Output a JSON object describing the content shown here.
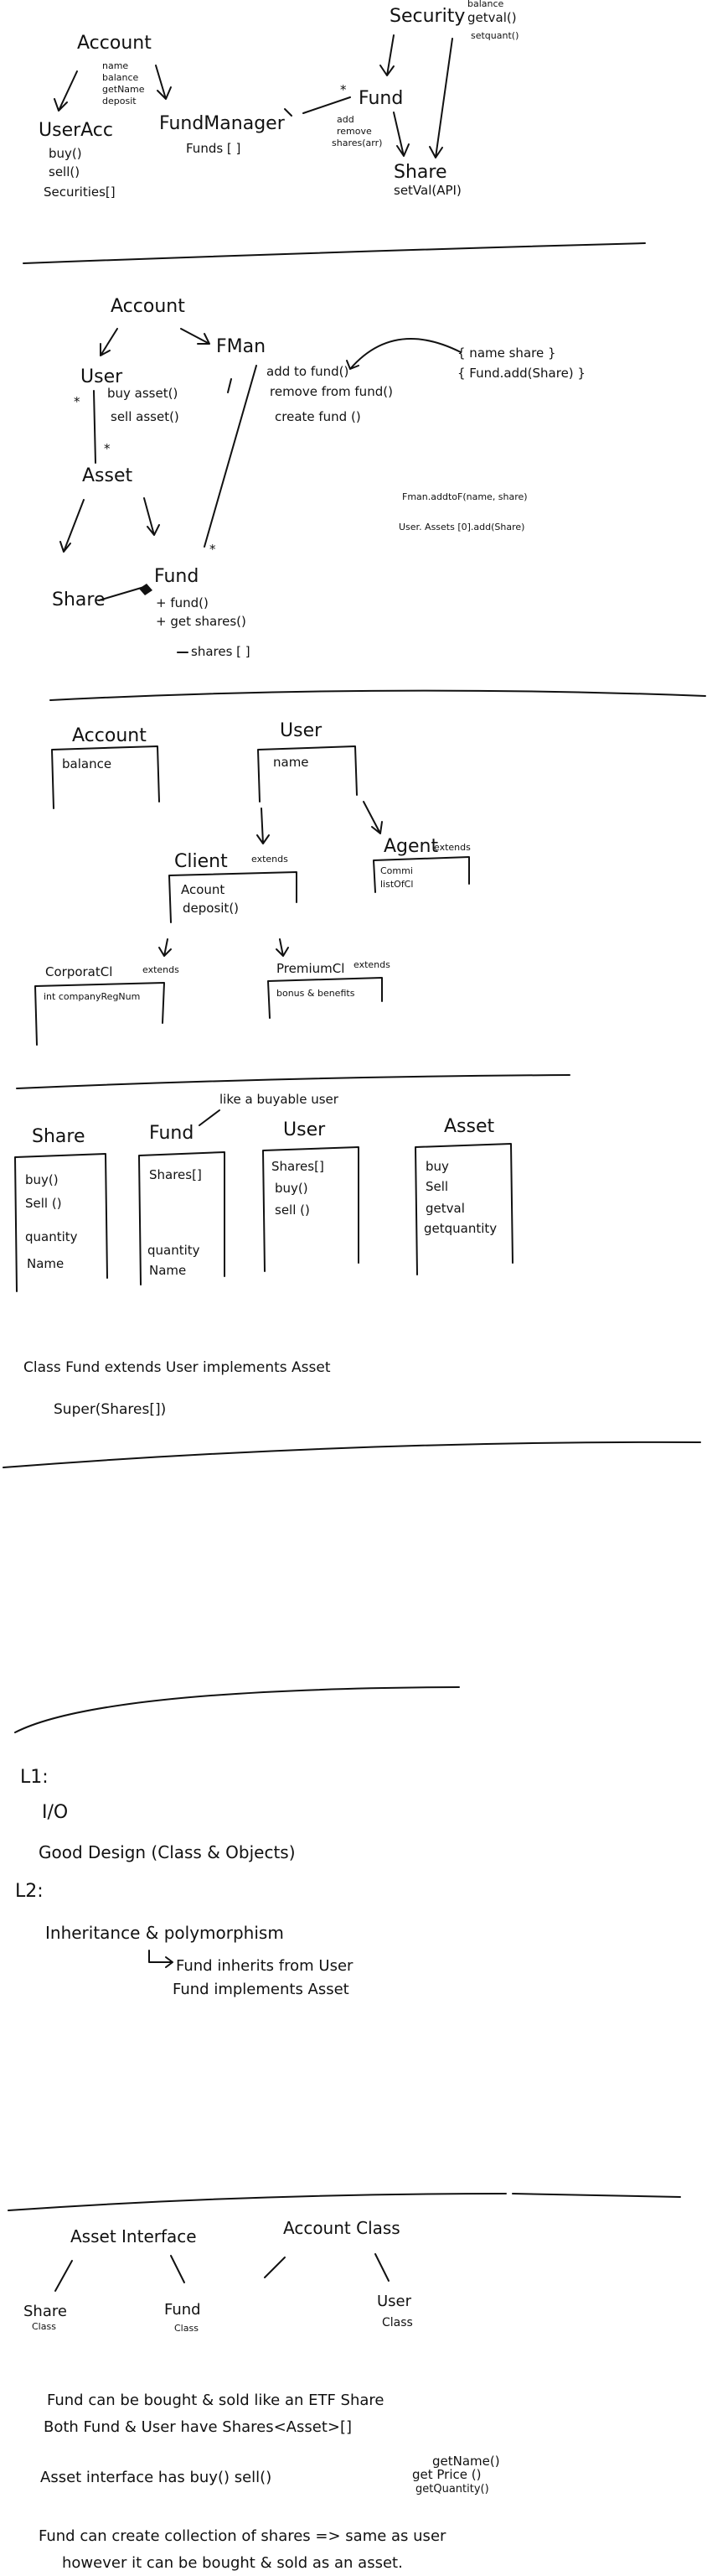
{
  "s1": {
    "account": {
      "title": "Account",
      "fields": [
        "name",
        "balance",
        "getName",
        "deposit"
      ]
    },
    "useracc": {
      "title": "UserAcc",
      "methods": [
        "buy()",
        "sell()",
        "Securities[]"
      ]
    },
    "fundmanager": {
      "title": "FundManager",
      "fields": [
        "Funds [ ]"
      ]
    },
    "security": {
      "title": "Security",
      "methods": [
        "balance",
        "getval()",
        "setquant()"
      ]
    },
    "fund": {
      "title": "Fund",
      "methods": [
        "add",
        "remove",
        "shares(arr)"
      ]
    },
    "share": {
      "title": "Share",
      "methods": [
        "setVal(API)"
      ]
    },
    "star": "*"
  },
  "s2": {
    "account": "Account",
    "user": "User",
    "user_methods": [
      "buy asset()",
      "sell asset()"
    ],
    "fman": "FMan",
    "fman_methods": [
      "add to fund()",
      "remove from fund()",
      "create fund ()"
    ],
    "brace_note": [
      "{ name   share }",
      "{ Fund.add(Share) }"
    ],
    "asset": "Asset",
    "share": "Share",
    "fund": "Fund",
    "fund_methods": [
      "+ fund()",
      "+ get shares()"
    ],
    "shares_note": "shares [ ]",
    "code_lines": [
      "Fman.addtoF(name, share)",
      "User. Assets [0].add(Share)"
    ],
    "star": "*"
  },
  "s3": {
    "account": {
      "title": "Account",
      "field": "balance"
    },
    "user": {
      "title": "User",
      "field": "name"
    },
    "client": {
      "title": "Client",
      "ext": "extends",
      "fields": [
        "Acount",
        "deposit()"
      ]
    },
    "agent": {
      "title": "Agent",
      "ext": "extends",
      "fields": [
        "Commi",
        "listOfCl"
      ]
    },
    "corporate": {
      "title": "CorporatCl",
      "ext": "extends",
      "field": "int companyRegNum"
    },
    "premium": {
      "title": "PremiumCl",
      "ext": "extends",
      "field": "bonus & benefits"
    }
  },
  "s4": {
    "note": "like a buyable user",
    "share": {
      "title": "Share",
      "items": [
        "buy()",
        "Sell ()",
        "quantity",
        "Name"
      ]
    },
    "fund": {
      "title": "Fund",
      "items": [
        "Shares[]",
        "quantity",
        "Name"
      ]
    },
    "user": {
      "title": "User",
      "items": [
        "Shares[]",
        "buy()",
        "sell ()"
      ]
    },
    "asset": {
      "title": "Asset",
      "items": [
        "buy",
        "Sell",
        "getval",
        "getquantity"
      ]
    },
    "code": [
      "Class Fund extends User implements Asset",
      "Super(Shares[])"
    ]
  },
  "s5": {
    "lines": [
      "L1:",
      "I/O",
      "Good Design (Class & Objects)",
      "L2:",
      "Inheritance & polymorphism",
      "Fund inherits from User",
      "Fund implements Asset"
    ]
  },
  "s6": {
    "asset_interface": "Asset Interface",
    "account_class": "Account Class",
    "share": "Share",
    "fund": "Fund",
    "user": "User",
    "class_label": "Class",
    "notes": [
      "Fund can be bought & sold like an ETF Share",
      "Both Fund & User have Shares<Asset>[]",
      "Asset interface has buy() sell()",
      "Fund can create collection of shares => same as user",
      "however it can be bought & sold as an asset."
    ],
    "getters": [
      "getName()",
      "get Price ()",
      "getQuantity()"
    ]
  }
}
